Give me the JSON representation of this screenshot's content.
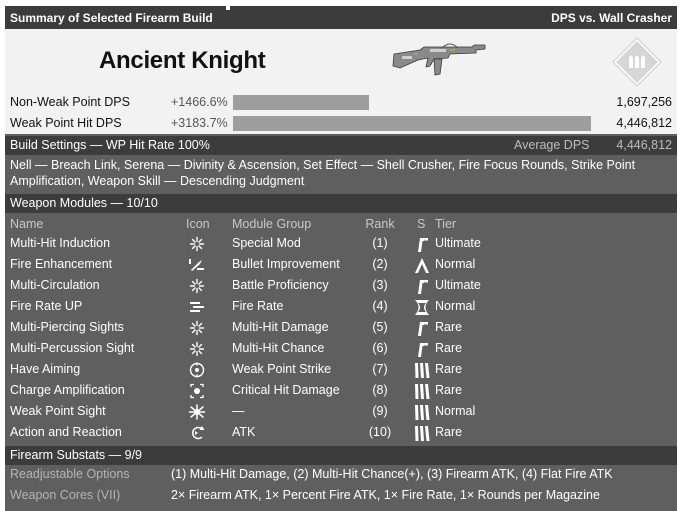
{
  "title_left": "Summary of Selected Firearm Build",
  "title_right": "DPS vs. Wall Crasher",
  "build_name": "Ancient Knight",
  "dps_rows": [
    {
      "label": "Non-Weak Point DPS",
      "pct": "+1466.6%",
      "value": "1,697,256",
      "fill": 0.381
    },
    {
      "label": "Weak Point Hit DPS",
      "pct": "+3183.7%",
      "value": "4,446,812",
      "fill": 1.0
    }
  ],
  "build_settings": {
    "label": "Build Settings — WP Hit Rate 100%",
    "avg_label": "Average DPS",
    "avg_value": "4,446,812",
    "text": "Nell — Breach Link, Serena — Divinity & Ascension, Set Effect — Shell Crusher, Fire Focus Rounds, Strike Point Amplification, Weapon Skill — Descending Judgment"
  },
  "modules": {
    "title": "Weapon Modules — 10/10",
    "headers": {
      "name": "Name",
      "icon": "Icon",
      "group": "Module Group",
      "rank": "Rank",
      "s": "S",
      "tier": "Tier"
    },
    "rows": [
      {
        "name": "Multi-Hit Induction",
        "icon": "multi-hit-icon",
        "group": "Special Mod",
        "rank": "(1)",
        "socket": "slash-socket-icon",
        "tier": "Ultimate"
      },
      {
        "name": "Fire Enhancement",
        "icon": "bullet-icon",
        "group": "Bullet Improvement",
        "rank": "(2)",
        "socket": "chevron-socket-icon",
        "tier": "Normal"
      },
      {
        "name": "Multi-Circulation",
        "icon": "multi-hit-icon",
        "group": "Battle Proficiency",
        "rank": "(3)",
        "socket": "slash-socket-icon",
        "tier": "Ultimate"
      },
      {
        "name": "Fire Rate UP",
        "icon": "fire-rate-icon",
        "group": "Fire Rate",
        "rank": "(4)",
        "socket": "cross-socket-icon",
        "tier": "Normal"
      },
      {
        "name": "Multi-Piercing Sights",
        "icon": "multi-hit-icon",
        "group": "Multi-Hit Damage",
        "rank": "(5)",
        "socket": "slash-socket-icon",
        "tier": "Rare"
      },
      {
        "name": "Multi-Percussion Sight",
        "icon": "multi-hit-icon",
        "group": "Multi-Hit Chance",
        "rank": "(6)",
        "socket": "slash-socket-icon",
        "tier": "Rare"
      },
      {
        "name": "Have Aiming",
        "icon": "weak-point-icon",
        "group": "Weak Point Strike",
        "rank": "(7)",
        "socket": "bars-socket-icon",
        "tier": "Rare"
      },
      {
        "name": "Charge Amplification",
        "icon": "critical-icon",
        "group": "Critical Hit Damage",
        "rank": "(8)",
        "socket": "bars-socket-icon",
        "tier": "Rare"
      },
      {
        "name": "Weak Point Sight",
        "icon": "burst-icon",
        "group": "—",
        "rank": "(9)",
        "socket": "bars-socket-icon",
        "tier": "Normal"
      },
      {
        "name": "Action and Reaction",
        "icon": "recoil-icon",
        "group": "ATK",
        "rank": "(10)",
        "socket": "bars-socket-icon",
        "tier": "Rare"
      }
    ]
  },
  "substats": {
    "title": "Firearm Substats — 9/9",
    "rows": [
      {
        "key": "Readjustable Options",
        "value": "(1) Multi-Hit Damage, (2) Multi-Hit Chance(+), (3) Firearm ATK, (4) Flat Fire ATK"
      },
      {
        "key": "Weapon Cores (VII)",
        "value": "2× Firearm ATK, 1× Percent Fire ATK, 1× Fire Rate, 1× Rounds per Magazine"
      }
    ]
  }
}
